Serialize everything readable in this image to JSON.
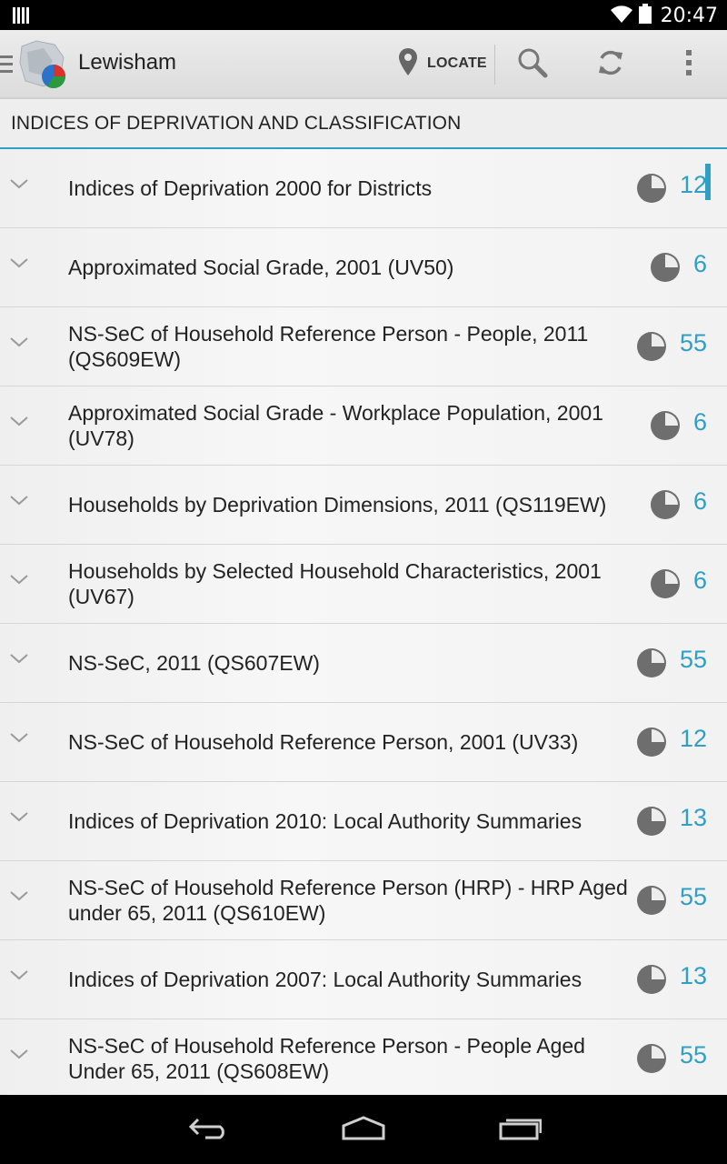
{
  "status_bar": {
    "time": "20:47"
  },
  "action_bar": {
    "title": "Lewisham",
    "locate_label": "LOCATE",
    "icons": [
      "menu-icon",
      "app-logo",
      "location-pin-icon",
      "search-icon",
      "refresh-icon",
      "overflow-menu-icon"
    ]
  },
  "section": {
    "title": "INDICES OF DEPRIVATION AND CLASSIFICATION"
  },
  "items": [
    {
      "label": "Indices of Deprivation 2000 for Districts",
      "count": "12"
    },
    {
      "label": "Approximated Social Grade, 2001 (UV50)",
      "count": "6"
    },
    {
      "label": "NS-SeC of Household Reference Person - People, 2011 (QS609EW)",
      "count": "55"
    },
    {
      "label": "Approximated Social Grade - Workplace Population, 2001 (UV78)",
      "count": "6"
    },
    {
      "label": "Households by Deprivation Dimensions, 2011 (QS119EW)",
      "count": "6"
    },
    {
      "label": "Households by Selected Household Characteristics, 2001 (UV67)",
      "count": "6"
    },
    {
      "label": "NS-SeC, 2011 (QS607EW)",
      "count": "55"
    },
    {
      "label": "NS-SeC of Household Reference Person, 2001 (UV33)",
      "count": "12"
    },
    {
      "label": "Indices of Deprivation 2010:  Local Authority Summaries",
      "count": "13"
    },
    {
      "label": "NS-SeC of Household Reference Person (HRP) - HRP Aged under 65, 2011 (QS610EW)",
      "count": "55"
    },
    {
      "label": "Indices of Deprivation 2007:  Local Authority Summaries",
      "count": "13"
    },
    {
      "label": "NS-SeC of Household Reference Person - People Aged Under 65, 2011 (QS608EW)",
      "count": "55"
    }
  ],
  "nav_bar": {
    "icons": [
      "back-icon",
      "home-icon",
      "recents-icon"
    ]
  },
  "colors": {
    "accent": "#2f9fc3",
    "pie": "#6e6e6e"
  }
}
